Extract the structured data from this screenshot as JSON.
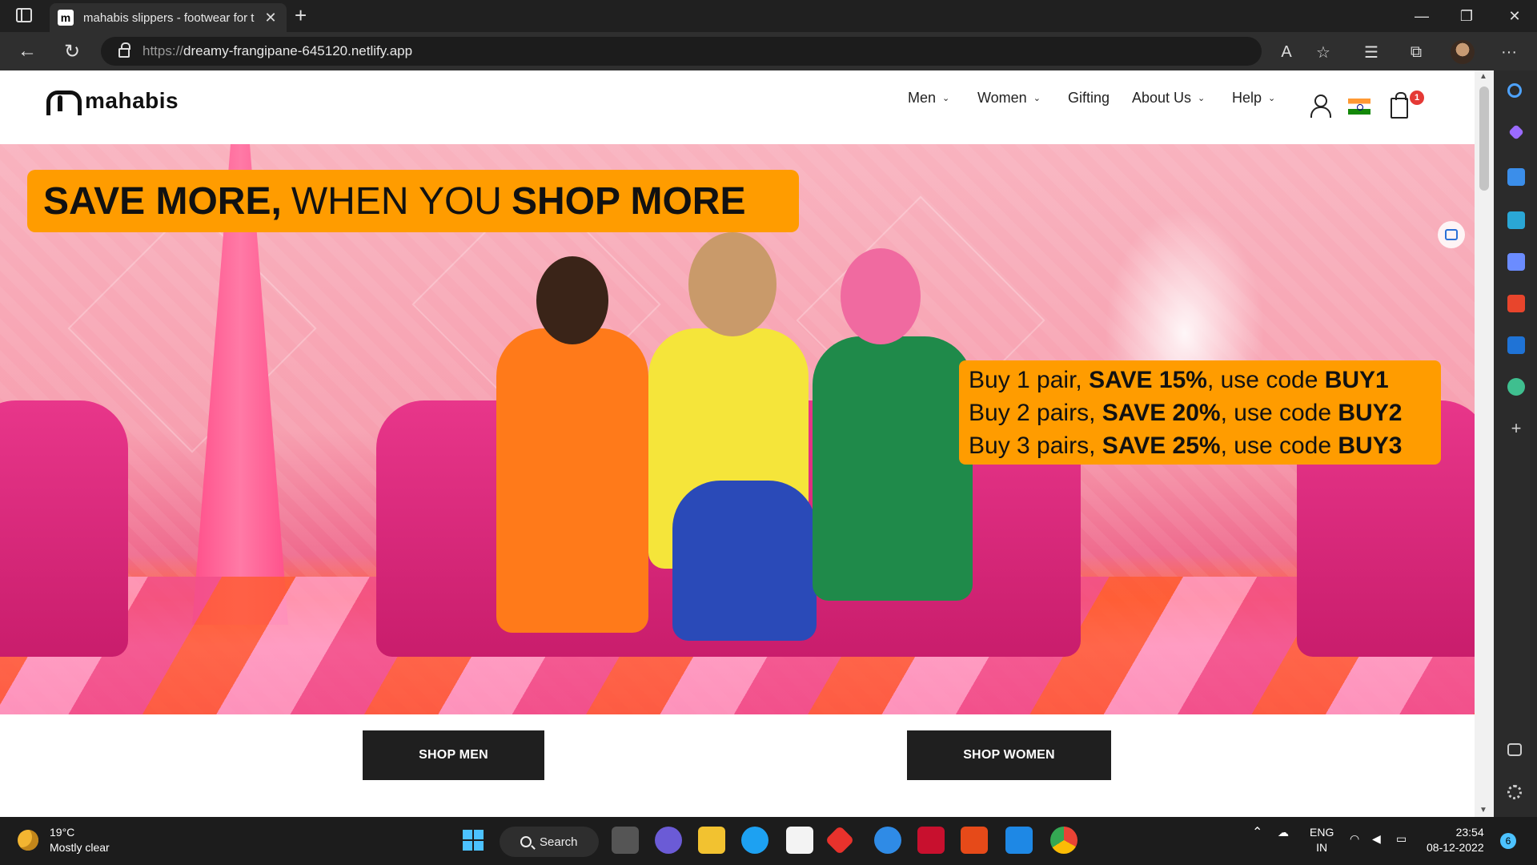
{
  "browser": {
    "tab_title": "mahabis slippers - footwear for t",
    "tab_favicon": "m",
    "url_scheme": "https://",
    "url_host": "dreamy-frangipane-645120.netlify.app",
    "new_tab_glyph": "+",
    "close_glyph": "✕",
    "minimize_glyph": "—",
    "restore_glyph": "❐",
    "back_glyph": "←",
    "refresh_glyph": "↻",
    "more_glyph": "···",
    "read_aloud_glyph": "A",
    "favorite_glyph": "☆",
    "favorites_glyph": "☰",
    "collections_glyph": "⧉"
  },
  "site": {
    "logo_text": "mahabis",
    "nav": [
      {
        "label": "Men",
        "has_dropdown": true
      },
      {
        "label": "Women",
        "has_dropdown": true
      },
      {
        "label": "Gifting",
        "has_dropdown": false
      },
      {
        "label": "About Us",
        "has_dropdown": true
      },
      {
        "label": "Help",
        "has_dropdown": true
      }
    ],
    "chevron_glyph": "⌄",
    "cart_count": "1",
    "hero": {
      "headline_bold_1": "SAVE MORE,",
      "headline_thin": "WHEN YOU",
      "headline_bold_2": "SHOP MORE",
      "offers": [
        {
          "pre": "Buy 1 pair, ",
          "save": "SAVE 15%",
          "mid": ",  use code ",
          "code": "BUY1"
        },
        {
          "pre": "Buy 2 pairs, ",
          "save": "SAVE 20%",
          "mid": ", use code ",
          "code": "BUY2"
        },
        {
          "pre": "Buy 3 pairs, ",
          "save": "SAVE 25%",
          "mid": ", use code ",
          "code": "BUY3"
        }
      ]
    },
    "shop_men_label": "SHOP MEN",
    "shop_women_label": "SHOP WOMEN"
  },
  "taskbar": {
    "temperature": "19°C",
    "weather": "Mostly clear",
    "search_label": "Search",
    "lang_top": "ENG",
    "lang_bottom": "IN",
    "time": "23:54",
    "date": "08-12-2022",
    "notification_count": "6"
  },
  "colors": {
    "banner": "#ff9c00",
    "button_bg": "#1f1f1f",
    "cart_badge": "#e53935"
  }
}
